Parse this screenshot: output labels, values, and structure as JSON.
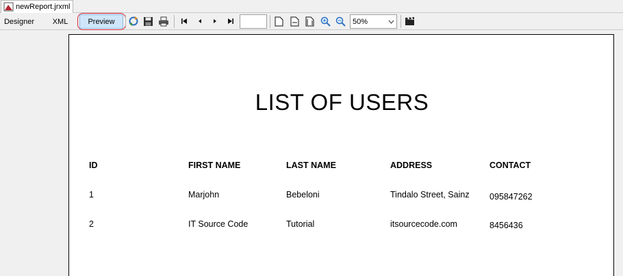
{
  "tab": {
    "filename": "newReport.jrxml"
  },
  "toolbar": {
    "designer_label": "Designer",
    "xml_label": "XML",
    "preview_label": "Preview",
    "page_number_value": "",
    "zoom_value": "50%"
  },
  "report": {
    "title": "LIST OF USERS",
    "columns": [
      "ID",
      "FIRST NAME",
      "LAST NAME",
      "ADDRESS",
      "CONTACT"
    ],
    "rows": [
      [
        "1",
        "Marjohn",
        "Bebeloni",
        "Tindalo Street, Sainz",
        "095847262"
      ],
      [
        "2",
        "IT Source Code",
        "Tutorial",
        "itsourcecode.com",
        "8456436"
      ]
    ]
  },
  "colors": {
    "highlight": "#d92b3a",
    "preview_active": "#cfe6fa"
  }
}
